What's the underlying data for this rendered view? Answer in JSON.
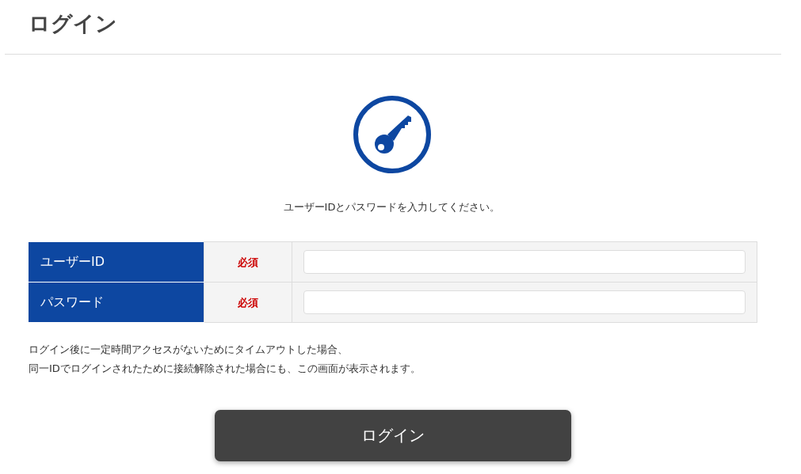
{
  "header": {
    "title": "ログイン"
  },
  "instruction": "ユーザーIDとパスワードを入力してください。",
  "fields": [
    {
      "label": "ユーザーID",
      "required": "必須"
    },
    {
      "label": "パスワード",
      "required": "必須"
    }
  ],
  "notes": [
    "ログイン後に一定時間アクセスがないためにタイムアウトした場合、",
    "同一IDでログインされたために接続解除された場合にも、この画面が表示されます。"
  ],
  "submit_button": "ログイン"
}
